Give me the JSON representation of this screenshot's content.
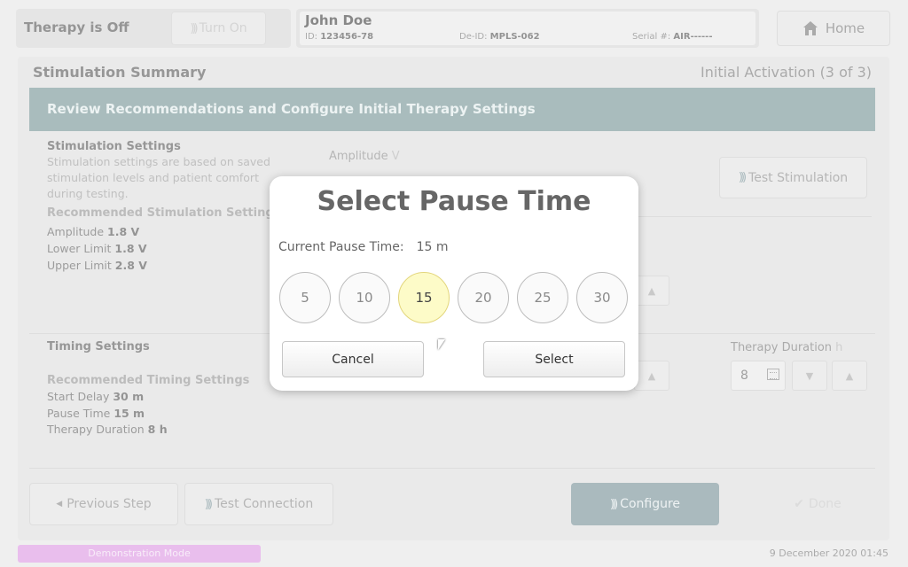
{
  "status": {
    "label": "Therapy is Off",
    "turn_on_label": "Turn On"
  },
  "patient": {
    "name": "John Doe",
    "id_label": "ID:",
    "id": "123456-78",
    "deid_label": "De-ID:",
    "deid": "MPLS-062",
    "serial_label": "Serial #:",
    "serial": "AIR------"
  },
  "home": {
    "label": "Home"
  },
  "main": {
    "title": "Stimulation Summary",
    "step": "Initial Activation (3 of 3)",
    "banner": "Review Recommendations and Configure Initial Therapy Settings"
  },
  "stim": {
    "heading": "Stimulation Settings",
    "desc": "Stimulation settings are based on saved stimulation levels and patient comfort during testing.",
    "rec_heading": "Recommended Stimulation Settings",
    "amp_label": "Amplitude",
    "amp_value": "1.8 V",
    "lower_label": "Lower Limit",
    "lower_value": "1.8 V",
    "upper_label": "Upper Limit",
    "upper_value": "2.8 V",
    "amplitude_field_label": "Amplitude",
    "amplitude_field_unit": "V",
    "test_stim_label": "Test Stimulation"
  },
  "timing": {
    "heading": "Timing Settings",
    "rec_heading": "Recommended Timing Settings",
    "start_label": "Start Delay",
    "start_value": "30 m",
    "pause_label": "Pause Time",
    "pause_value": "15 m",
    "duration_label": "Therapy Duration",
    "duration_value": "8 h",
    "therapy_duration_field_label": "Therapy Duration",
    "therapy_duration_field_unit": "h",
    "therapy_duration_field_value": "8"
  },
  "footer_buttons": {
    "previous": "Previous Step",
    "test_connection": "Test Connection",
    "configure": "Configure",
    "done": "Done"
  },
  "footer": {
    "demo_mode": "Demonstration Mode",
    "datetime": "9 December 2020 01:45"
  },
  "dialog": {
    "title": "Select Pause Time",
    "current_label": "Current Pause Time:",
    "current_value": "15 m",
    "options": [
      "5",
      "10",
      "15",
      "20",
      "25",
      "30"
    ],
    "selected": "15",
    "cancel_label": "Cancel",
    "select_label": "Select"
  },
  "colors": {
    "banner": "#88a2a4",
    "configure": "#8aa0a6",
    "selected_option": "#fdfbc8",
    "demo_badge": "#e1a5e6"
  },
  "icons": [
    "sound-wave-icon",
    "home-icon",
    "calendar-icon",
    "chevron-down-icon",
    "chevron-up-icon",
    "arrow-left-icon",
    "check-icon",
    "mouse-cursor-icon"
  ]
}
